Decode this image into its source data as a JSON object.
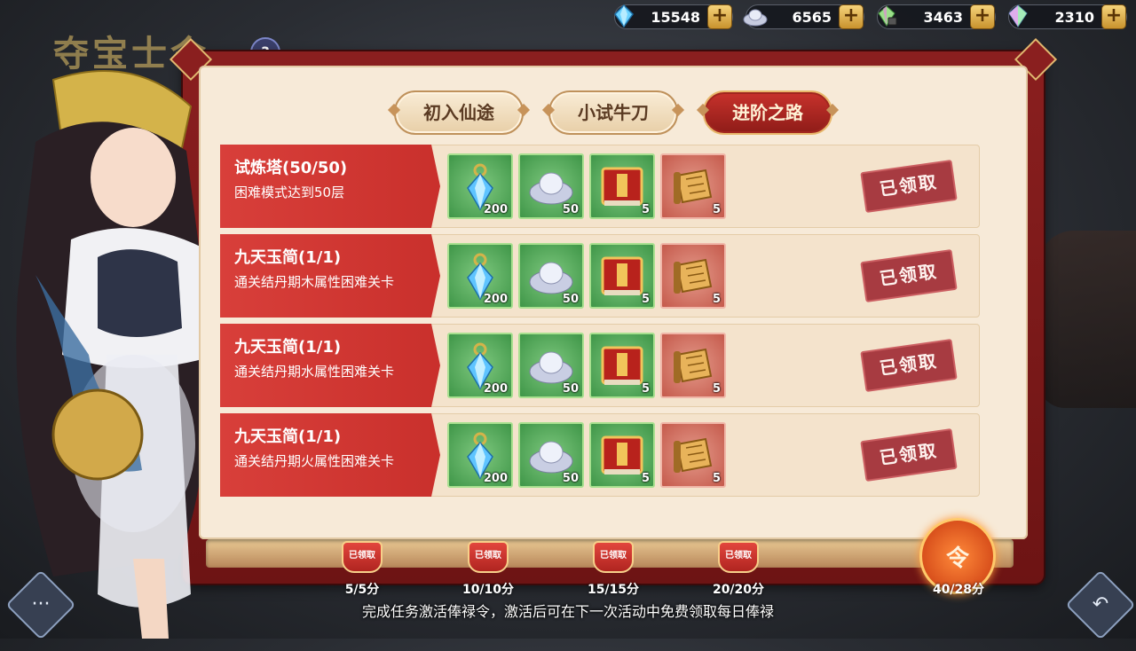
{
  "background": {
    "event_title": "夺宝士令",
    "help_badge": "?"
  },
  "resources": [
    {
      "icon": "blue-crystal-icon",
      "value": "15548",
      "plus": "+"
    },
    {
      "icon": "silver-ingot-icon",
      "value": "6565",
      "plus": "+"
    },
    {
      "icon": "locked-gem-icon",
      "value": "3463",
      "plus": "+"
    },
    {
      "icon": "rainbow-crystal-icon",
      "value": "2310",
      "plus": "+"
    }
  ],
  "tabs": [
    {
      "label": "初入仙途",
      "active": false
    },
    {
      "label": "小试牛刀",
      "active": false
    },
    {
      "label": "进阶之路",
      "active": true
    }
  ],
  "tasks": [
    {
      "title": "试炼塔(50/50)",
      "desc": "困难模式达到50层",
      "rewards": [
        {
          "icon": "blue-spirit-stone-icon",
          "qty": "200",
          "rarity": "green"
        },
        {
          "icon": "silver-ingot-icon",
          "qty": "50",
          "rarity": "green"
        },
        {
          "icon": "red-book-icon",
          "qty": "5",
          "rarity": "green"
        },
        {
          "icon": "scroll-icon",
          "qty": "5",
          "rarity": "red"
        }
      ],
      "status": "已领取"
    },
    {
      "title": "九天玉简(1/1)",
      "desc": "通关结丹期木属性困难关卡",
      "rewards": [
        {
          "icon": "blue-spirit-stone-icon",
          "qty": "200",
          "rarity": "green"
        },
        {
          "icon": "silver-ingot-icon",
          "qty": "50",
          "rarity": "green"
        },
        {
          "icon": "red-book-icon",
          "qty": "5",
          "rarity": "green"
        },
        {
          "icon": "scroll-icon",
          "qty": "5",
          "rarity": "red"
        }
      ],
      "status": "已领取"
    },
    {
      "title": "九天玉简(1/1)",
      "desc": "通关结丹期水属性困难关卡",
      "rewards": [
        {
          "icon": "blue-spirit-stone-icon",
          "qty": "200",
          "rarity": "green"
        },
        {
          "icon": "silver-ingot-icon",
          "qty": "50",
          "rarity": "green"
        },
        {
          "icon": "red-book-icon",
          "qty": "5",
          "rarity": "green"
        },
        {
          "icon": "scroll-icon",
          "qty": "5",
          "rarity": "red"
        }
      ],
      "status": "已领取"
    },
    {
      "title": "九天玉简(1/1)",
      "desc": "通关结丹期火属性困难关卡",
      "rewards": [
        {
          "icon": "blue-spirit-stone-icon",
          "qty": "200",
          "rarity": "green"
        },
        {
          "icon": "silver-ingot-icon",
          "qty": "50",
          "rarity": "green"
        },
        {
          "icon": "red-book-icon",
          "qty": "5",
          "rarity": "green"
        },
        {
          "icon": "scroll-icon",
          "qty": "5",
          "rarity": "red"
        }
      ],
      "status": "已领取"
    }
  ],
  "partial_row_qtys": [
    "200",
    "50",
    "5",
    "5"
  ],
  "milestones": [
    {
      "label": "5/5分",
      "seal": "已领取"
    },
    {
      "label": "10/10分",
      "seal": "已领取"
    },
    {
      "label": "15/15分",
      "seal": "已领取"
    },
    {
      "label": "20/20分",
      "seal": "已领取"
    }
  ],
  "token": {
    "glyph": "令",
    "label": "40/28分"
  },
  "footer": "完成任务激活俸禄令，激活后可在下一次活动中免费领取每日俸禄",
  "colors": {
    "panel_red": "#8a1f1f",
    "row_red": "#d83f3a",
    "parchment": "#f7ead8",
    "tab_active": "#c8322c",
    "reward_green": "#3f9648",
    "reward_red": "#c55a4c",
    "gold": "#f5d27a"
  }
}
